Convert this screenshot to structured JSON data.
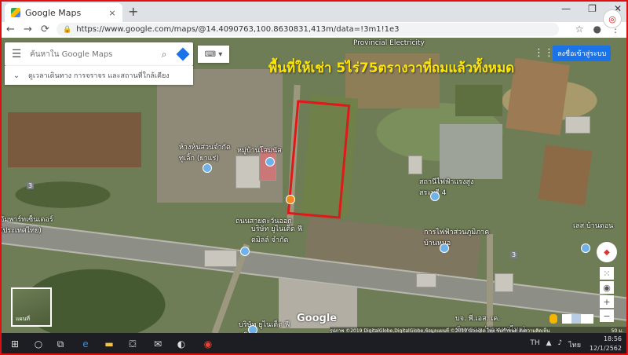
{
  "browser": {
    "tab_title": "Google Maps",
    "tab_close": "×",
    "new_tab": "+",
    "window_buttons": [
      "—",
      "❐",
      "✕"
    ],
    "url": "https://www.google.com/maps/@14.4090763,100.8630831,413m/data=!3m1!1e3",
    "lock_icon": "🔒",
    "nav": {
      "back": "←",
      "forward": "→",
      "reload": "⟳"
    },
    "right_icons": [
      "☆",
      "●",
      "⋮"
    ]
  },
  "maps": {
    "search_placeholder": "ค้นหาใน Google Maps",
    "explore_text": "ดูเวลาเดินทาง การจราจร และสถานที่ใกล้เคียง",
    "signin_label": "ลงชื่อเข้าสู่ระบบ",
    "overlay_text": "พื้นที่ให้เช่า 5ไร่75ตรางวาที่ถมแล้วทั้งหมด",
    "labels": {
      "provincial": "Provincial Electricity",
      "shop": "ห้างหุ้นส่วนจำกัด ทูเลิ้ก (ยาแร่)",
      "village": "หมู่บ้านโสมนัส",
      "substation": "สถานีไฟฟ้าแรงสูงสระบุรี 4",
      "pea": "การไฟฟ้าส่วนภูมิภาค บ้านหมอ",
      "company": "บริษัท ยูไนเต็ด ฟีดมิลล์ จำกัด",
      "road": "ถนนสายตะวันออก",
      "left": "อัมพาร์ทเซ็นเตอร์ (ประเทศไทย)",
      "bottom_company": "บริษัท ยูไนเต็ด ฟีดมิลล์",
      "bottom_right": "บจ. พี.เอส. เค. ซัพพลาย (ประเทศไทย)",
      "right_top": "เลส บ้านดอน"
    },
    "route_shield": "3",
    "minimap_label": "แผนที่",
    "google_logo": "Google",
    "attribution": "รูปภาพ ©2019 DigitalGlobe,DigitalGlobe,ข้อมูลแผนที่ ©2019 Google ไทย ข้อกำหนด ส่งความคิดเห็น",
    "scale": "50 ม.",
    "zoom_in": "+",
    "zoom_out": "−"
  },
  "taskbar": {
    "time": "18:56",
    "date": "12/1/2562",
    "lang": "ไทย",
    "tray_text": "TH"
  }
}
